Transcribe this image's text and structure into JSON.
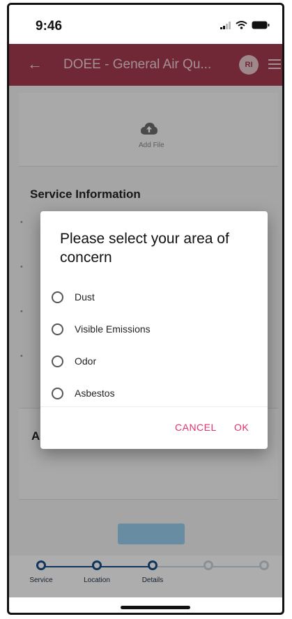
{
  "status_bar": {
    "time": "9:46"
  },
  "app_bar": {
    "title": "DOEE - General Air Qu...",
    "avatar_initials": "RI"
  },
  "upload": {
    "label": "Add File"
  },
  "form": {
    "section_title": "Service Information",
    "section2_letter": "A"
  },
  "stepper": {
    "steps": [
      {
        "label": "Service",
        "active": true
      },
      {
        "label": "Location",
        "active": true
      },
      {
        "label": "Details",
        "active": true
      },
      {
        "label": "",
        "active": false
      },
      {
        "label": "",
        "active": false
      }
    ]
  },
  "dialog": {
    "title": "Please select your area of concern",
    "options": [
      "Dust",
      "Visible Emissions",
      "Odor",
      "Asbestos"
    ],
    "cancel_label": "CANCEL",
    "ok_label": "OK"
  },
  "colors": {
    "app_bar": "#a63a50",
    "accent": "#e0346a",
    "stepper": "#1b4f88"
  }
}
